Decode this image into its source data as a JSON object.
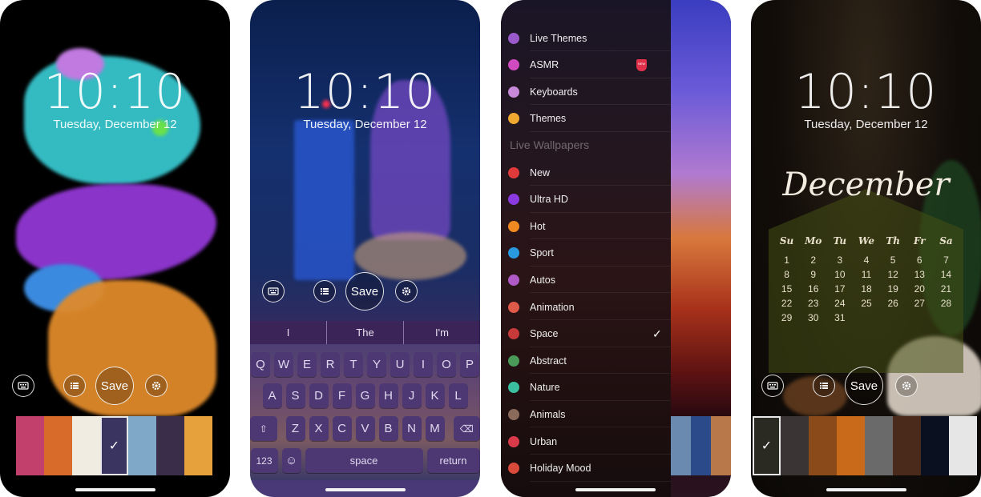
{
  "lockscreen": {
    "time": "10:10",
    "date": "Tuesday, December 12"
  },
  "actions": {
    "save_label": "Save",
    "keyboard_icon": "keyboard-icon",
    "list_icon": "list-icon",
    "settings_icon": "gear-icon"
  },
  "phone1": {
    "thumbs": [
      {
        "name": "dahlia",
        "color": "#c2406c"
      },
      {
        "name": "orange-spheres",
        "color": "#d86a2a"
      },
      {
        "name": "comic-burst",
        "color": "#f0ece2"
      },
      {
        "name": "paint-splash",
        "color": "#3a3560",
        "selected": true
      },
      {
        "name": "race-track",
        "color": "#7fa8c8"
      },
      {
        "name": "nebula",
        "color": "#3a2d4a"
      },
      {
        "name": "marble-swirl",
        "color": "#e6a03c"
      }
    ]
  },
  "phone2": {
    "suggestions": [
      "I",
      "The",
      "I'm"
    ],
    "keyboard": {
      "row1": [
        "Q",
        "W",
        "E",
        "R",
        "T",
        "Y",
        "U",
        "I",
        "O",
        "P"
      ],
      "row2": [
        "A",
        "S",
        "D",
        "F",
        "G",
        "H",
        "J",
        "K",
        "L"
      ],
      "row3": [
        "Z",
        "X",
        "C",
        "V",
        "B",
        "N",
        "M"
      ],
      "numbers_label": "123",
      "space_label": "space",
      "return_label": "return"
    }
  },
  "phone3": {
    "menu_top": [
      {
        "label": "Live Themes",
        "color": "#9b5acc"
      },
      {
        "label": "ASMR",
        "color": "#d04ac0",
        "badge": "NEW"
      },
      {
        "label": "Keyboards",
        "color": "#c88ad8"
      },
      {
        "label": "Themes",
        "color": "#f0a830"
      }
    ],
    "section_title": "Live Wallpapers",
    "menu_categories": [
      {
        "label": "New",
        "color": "#e03a3a"
      },
      {
        "label": "Ultra HD",
        "color": "#8a3ae0"
      },
      {
        "label": "Hot",
        "color": "#f08a20"
      },
      {
        "label": "Sport",
        "color": "#2a9ae0"
      },
      {
        "label": "Autos",
        "color": "#b05ac8"
      },
      {
        "label": "Animation",
        "color": "#e05a4a"
      },
      {
        "label": "Space",
        "color": "#c83a3a",
        "checked": true
      },
      {
        "label": "Abstract",
        "color": "#4a9a5a"
      },
      {
        "label": "Nature",
        "color": "#3ac0a0"
      },
      {
        "label": "Animals",
        "color": "#8a6a5a"
      },
      {
        "label": "Urban",
        "color": "#d83a4a"
      },
      {
        "label": "Holiday Mood",
        "color": "#d84a3a"
      }
    ],
    "check_glyph": "✓"
  },
  "phone4": {
    "calendar": {
      "month": "December",
      "weekdays": [
        "Su",
        "Mo",
        "Tu",
        "We",
        "Th",
        "Fr",
        "Sa"
      ],
      "days": [
        "1",
        "2",
        "3",
        "4",
        "5",
        "6",
        "7",
        "8",
        "9",
        "10",
        "11",
        "12",
        "13",
        "14",
        "15",
        "16",
        "17",
        "18",
        "19",
        "20",
        "21",
        "22",
        "23",
        "24",
        "25",
        "26",
        "27",
        "28",
        "29",
        "30",
        "31"
      ]
    },
    "thumbs": [
      {
        "name": "coffee-dark",
        "color": "#2a2a22",
        "selected": true
      },
      {
        "name": "flamingo",
        "color": "#3a3434"
      },
      {
        "name": "pastries",
        "color": "#8a4a1a"
      },
      {
        "name": "thanks-sign",
        "color": "#c86a1a"
      },
      {
        "name": "camera",
        "color": "#6a6a6a"
      },
      {
        "name": "be-grateful",
        "color": "#4a2a1a"
      },
      {
        "name": "earth-horizon",
        "color": "#0a1020"
      },
      {
        "name": "love-marble",
        "color": "#e6e6e6"
      }
    ]
  }
}
